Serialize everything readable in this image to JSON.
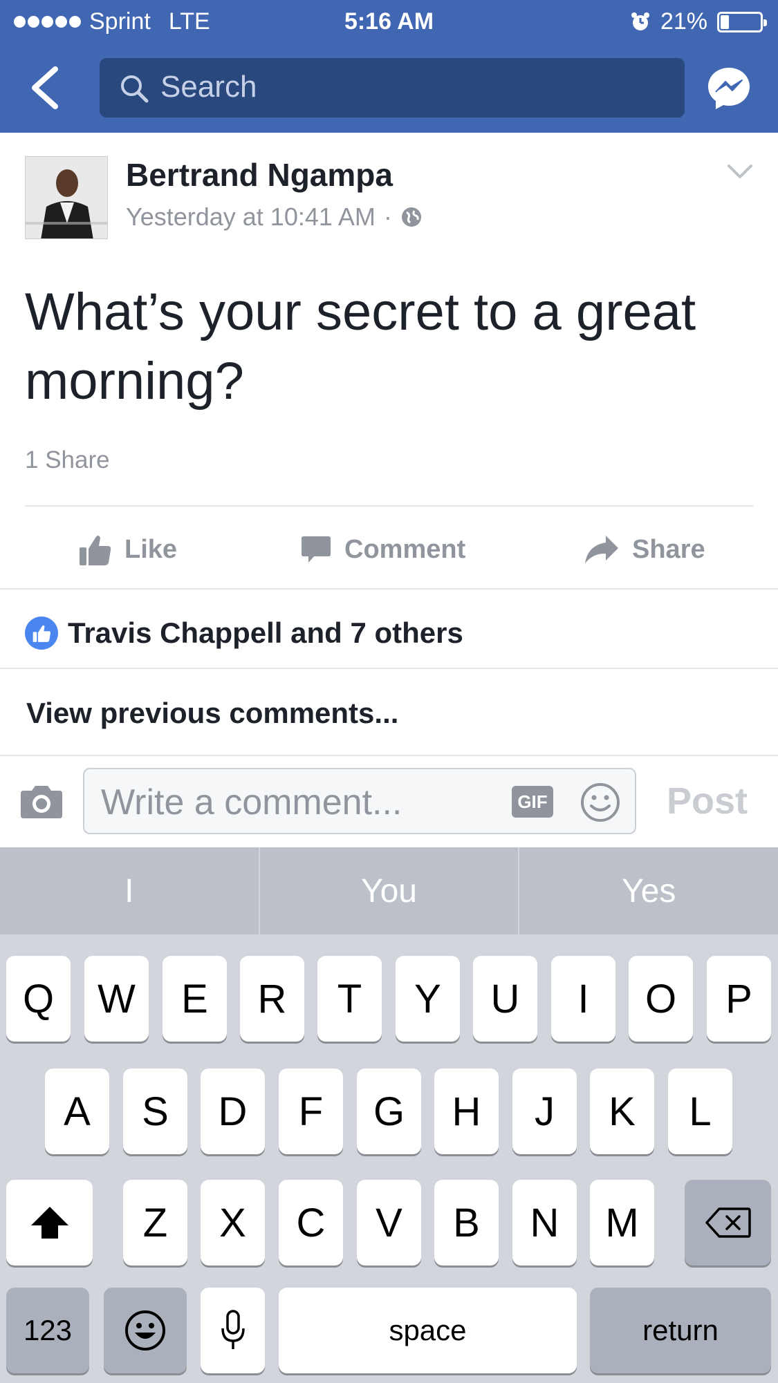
{
  "status_bar": {
    "carrier": "Sprint",
    "network": "LTE",
    "time": "5:16 AM",
    "battery": "21%"
  },
  "nav": {
    "search_placeholder": "Search"
  },
  "post": {
    "author": "Bertrand Ngampa",
    "timestamp": "Yesterday at 10:41 AM",
    "separator": "·",
    "text": "What’s your secret to a great morning?",
    "shares": "1 Share"
  },
  "actions": {
    "like": "Like",
    "comment": "Comment",
    "share": "Share"
  },
  "likes_summary": "Travis Chappell and 7 others",
  "view_previous": "View previous comments...",
  "composer": {
    "placeholder": "Write a comment...",
    "gif_label": "GIF",
    "post_label": "Post"
  },
  "keyboard": {
    "predictions": [
      "I",
      "You",
      "Yes"
    ],
    "row1": [
      "Q",
      "W",
      "E",
      "R",
      "T",
      "Y",
      "U",
      "I",
      "O",
      "P"
    ],
    "row2": [
      "A",
      "S",
      "D",
      "F",
      "G",
      "H",
      "J",
      "K",
      "L"
    ],
    "row3": [
      "Z",
      "X",
      "C",
      "V",
      "B",
      "N",
      "M"
    ],
    "numbers_key": "123",
    "space_key": "space",
    "return_key": "return"
  },
  "colors": {
    "brand": "#4267b2",
    "search_bg": "#29487d",
    "muted": "#90949c",
    "like_blue": "#4b86f0"
  }
}
